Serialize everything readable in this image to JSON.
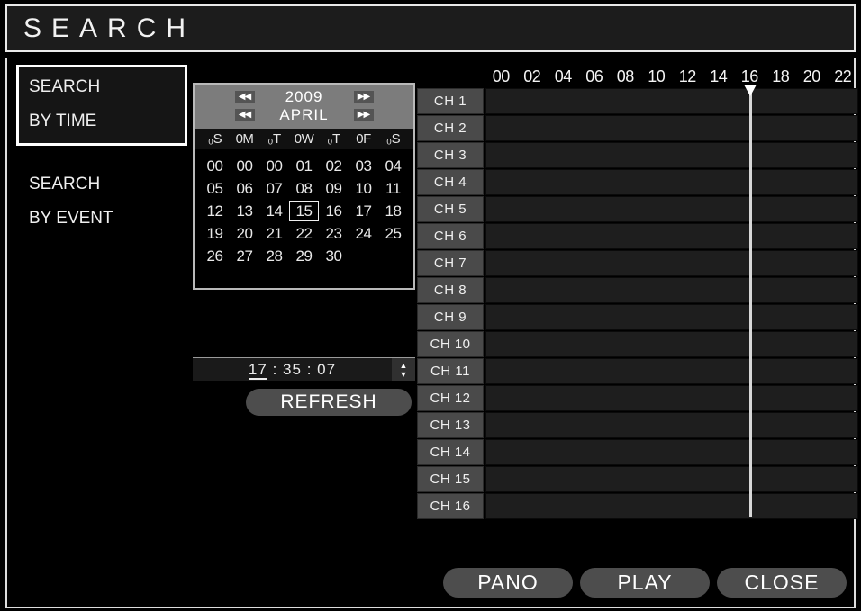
{
  "window": {
    "title": "SEARCH"
  },
  "sidebar": {
    "items": [
      {
        "line1": "SEARCH",
        "line2": "BY TIME",
        "selected": true
      },
      {
        "line1": "SEARCH",
        "line2": "BY EVENT",
        "selected": false
      }
    ]
  },
  "calendar": {
    "year": "2009",
    "month": "APRIL",
    "prev_year_icon": "◀◀",
    "next_year_icon": "▶▶",
    "prev_month_icon": "◀◀",
    "next_month_icon": "▶▶",
    "day_headers": [
      "₀S",
      "0M",
      "₀T",
      "0W",
      "₀T",
      "0F",
      "₀S"
    ],
    "weeks": [
      [
        "00",
        "00",
        "00",
        "01",
        "02",
        "03",
        "04"
      ],
      [
        "05",
        "06",
        "07",
        "08",
        "09",
        "10",
        "11"
      ],
      [
        "12",
        "13",
        "14",
        "15",
        "16",
        "17",
        "18"
      ],
      [
        "19",
        "20",
        "21",
        "22",
        "23",
        "24",
        "25"
      ],
      [
        "26",
        "27",
        "28",
        "29",
        "30",
        "",
        ""
      ]
    ],
    "selected_day": "15"
  },
  "time": {
    "hours": "17",
    "minutes": "35",
    "seconds": "07",
    "separator": ":",
    "spinner_up_icon": "▲",
    "spinner_down_icon": "▼"
  },
  "refresh": {
    "label": "REFRESH"
  },
  "timeline": {
    "hour_labels": [
      "00",
      "02",
      "04",
      "06",
      "08",
      "10",
      "12",
      "14",
      "16",
      "18",
      "20",
      "22"
    ],
    "channels": [
      "CH 1",
      "CH 2",
      "CH 3",
      "CH 4",
      "CH 5",
      "CH 6",
      "CH 7",
      "CH 8",
      "CH 9",
      "CH 10",
      "CH 11",
      "CH 12",
      "CH 13",
      "CH 14",
      "CH 15",
      "CH 16"
    ],
    "playhead_hour": "17.0"
  },
  "buttons": [
    {
      "label": "PANO"
    },
    {
      "label": "PLAY"
    },
    {
      "label": "CLOSE"
    }
  ],
  "colors": {
    "background": "#000000",
    "panel_gray": "#4a4a4a",
    "track_dark": "#1e1e1e",
    "nav_gray": "#7c7c7c",
    "text": "#f0f0f0"
  }
}
